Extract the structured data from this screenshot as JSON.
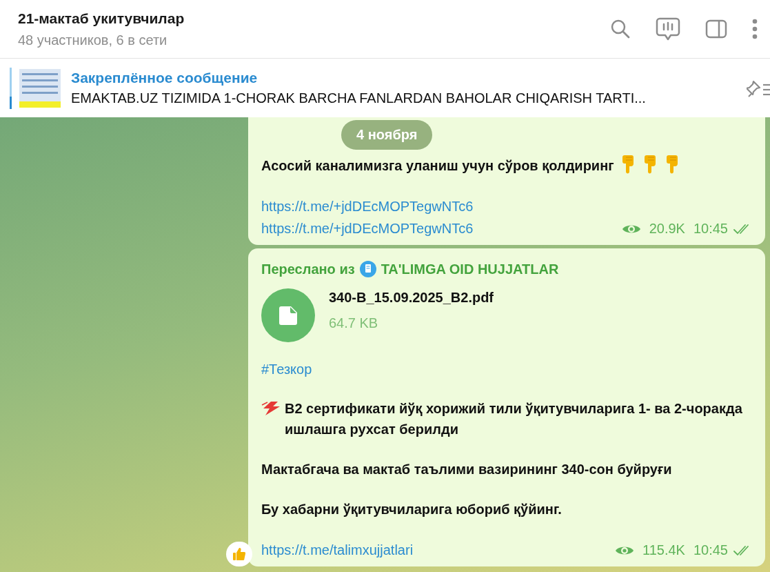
{
  "header": {
    "title": "21-мактаб укитувчилар",
    "subtitle": "48 участников, 6 в сети"
  },
  "pinned": {
    "label": "Закреплённое сообщение",
    "text": "EMAKTAB.UZ TIZIMIDA 1-CHORAK BARCHA FANLARDAN BAHOLAR CHIQARISH TARTI..."
  },
  "date_badge": "4 ноября",
  "messages": [
    {
      "kind": "text",
      "paragraphs": [
        {
          "kind": "hands-after",
          "text": "Асосий каналимизга уланиш учун сўров қолдиринг"
        }
      ],
      "links": [
        "https://t.me/+jdDEcMOPTegwNTc6",
        "https://t.me/+jdDEcMOPTegwNTc6"
      ],
      "views": "20.9K",
      "time": "10:45",
      "read": true,
      "reaction": false
    },
    {
      "kind": "forwarded",
      "forwarded_label": "Переслано из",
      "channel": "TA'LIMGA OID HUJJATLAR",
      "file": {
        "name": "340-B_15.09.2025_B2.pdf",
        "size": "64.7 KB"
      },
      "hashtag": "#Тезкор",
      "paragraphs": [
        {
          "kind": "lightning-before",
          "text": "B2 сертификати йўқ хорижий тили ўқитувчиларига 1- ва 2-чоракда ишлашга рухсат берилди"
        },
        {
          "kind": "plain",
          "text": "Мактабгача ва мактаб таълими вазирининг 340-сон буйруғи"
        },
        {
          "kind": "plain",
          "text": "Бу хабарни ўқитувчиларига юбориб қўйинг."
        }
      ],
      "links": [
        "https://t.me/talimxujjatlari"
      ],
      "views": "115.4K",
      "time": "10:45",
      "read": true,
      "reaction": true
    }
  ]
}
